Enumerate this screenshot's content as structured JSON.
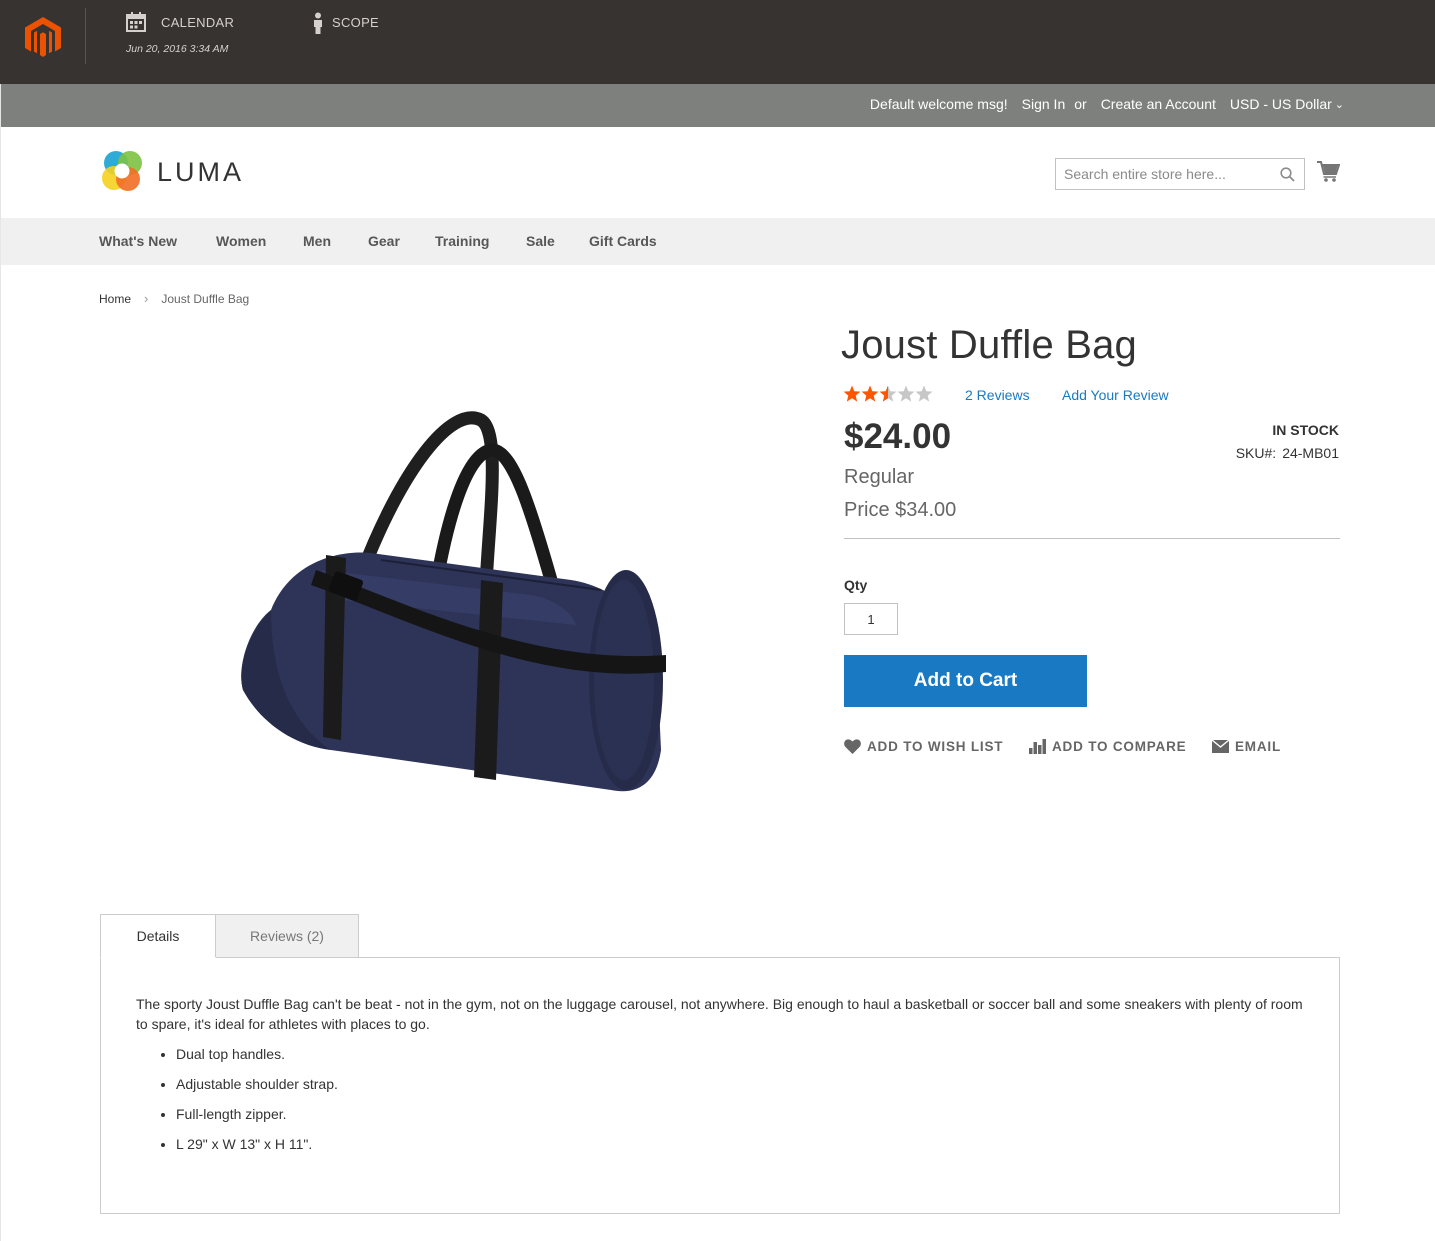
{
  "admin": {
    "calendar_label": "CALENDAR",
    "calendar_date": "Jun 20, 2016 3:34 AM",
    "scope_label": "SCOPE"
  },
  "panel": {
    "welcome": "Default welcome msg!",
    "sign_in": "Sign In",
    "or": "or",
    "create_account": "Create an Account",
    "currency": "USD - US Dollar"
  },
  "header": {
    "logo_text": "LUMA",
    "search_placeholder": "Search entire store here..."
  },
  "nav": {
    "items": [
      "What's New",
      "Women",
      "Men",
      "Gear",
      "Training",
      "Sale",
      "Gift Cards"
    ]
  },
  "breadcrumb": {
    "home": "Home",
    "separator": "›",
    "current": "Joust Duffle Bag"
  },
  "product": {
    "title": "Joust Duffle Bag",
    "rating_stars": 2.5,
    "rating_max": 5,
    "reviews_link": "2 Reviews",
    "add_review": "Add Your Review",
    "price": "$24.00",
    "regular_label": "Regular",
    "regular_price": "Price $34.00",
    "stock": "IN STOCK",
    "sku_label": "SKU#:",
    "sku_value": "24-MB01",
    "qty_label": "Qty",
    "qty_value": "1",
    "add_to_cart": "Add to Cart",
    "wish_list": "ADD TO WISH LIST",
    "compare": "ADD TO COMPARE",
    "email": "EMAIL"
  },
  "tabs": {
    "details": "Details",
    "reviews": "Reviews (2)"
  },
  "details": {
    "description": "The sporty Joust Duffle Bag can't be beat - not in the gym, not on the luggage carousel, not anywhere. Big enough to haul a basketball or soccer ball and some sneakers with plenty of room to spare, it's ideal for athletes with places to go.",
    "features": [
      "Dual top handles.",
      "Adjustable shoulder strap.",
      "Full-length zipper.",
      "L 29\" x W 13\" x H 11\"."
    ]
  },
  "colors": {
    "admin_bar": "#373330",
    "magento_orange": "#eb5202",
    "panel_bg": "#7e807e",
    "link_blue": "#1979c3",
    "star_orange": "#ff5501",
    "star_gray": "#c7c7c7"
  },
  "icons": {
    "admin_logo": "magento-logo-icon",
    "calendar": "calendar-icon",
    "scope": "person-icon",
    "search": "search-icon",
    "cart": "cart-icon",
    "wish": "heart-icon",
    "compare": "bar-chart-icon",
    "email": "envelope-icon"
  }
}
